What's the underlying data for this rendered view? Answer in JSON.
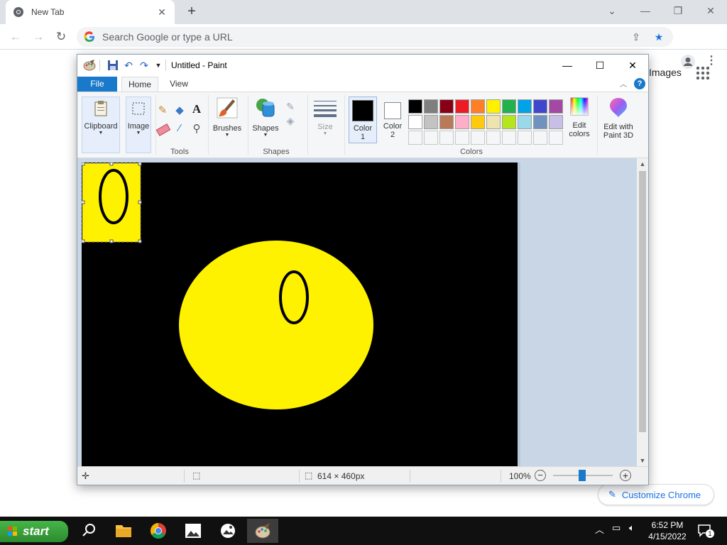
{
  "chrome": {
    "tab_title": "New Tab",
    "tab_close": "✕",
    "new_tab": "+",
    "omnibox_placeholder": "Search Google or type a URL",
    "ntp_images": "Images",
    "customize_label": "Customize Chrome"
  },
  "paint": {
    "title": "Untitled - Paint",
    "tabs": {
      "file": "File",
      "home": "Home",
      "view": "View"
    },
    "groups": {
      "clipboard": "Clipboard",
      "image": "Image",
      "tools": "Tools",
      "brushes": "Brushes",
      "shapes_btn": "Shapes",
      "shapes_group": "Shapes",
      "size": "Size",
      "color1_line1": "Color",
      "color1_line2": "1",
      "color2_line1": "Color",
      "color2_line2": "2",
      "edit_colors_line1": "Edit",
      "edit_colors_line2": "colors",
      "paint3d_line1": "Edit with",
      "paint3d_line2": "Paint 3D",
      "colors_group": "Colors"
    },
    "palette_row1": [
      "#000000",
      "#7f7f7f",
      "#880015",
      "#ed1c24",
      "#ff7f27",
      "#fff200",
      "#22b14c",
      "#00a2e8",
      "#3f48cc",
      "#a349a4"
    ],
    "palette_row2": [
      "#ffffff",
      "#c3c3c3",
      "#b97a57",
      "#ffaec9",
      "#ffc90e",
      "#efe4b0",
      "#b5e61d",
      "#99d9ea",
      "#7092be",
      "#c8bfe7"
    ],
    "color1": "#000000",
    "color2": "#ffffff",
    "canvas_bg": "#000000",
    "fill_color": "#fff200",
    "status": {
      "dimensions": "614 × 460px",
      "zoom": "100%"
    }
  },
  "taskbar": {
    "start": "start",
    "time": "6:52 PM",
    "date": "4/15/2022",
    "notifications": "1"
  }
}
